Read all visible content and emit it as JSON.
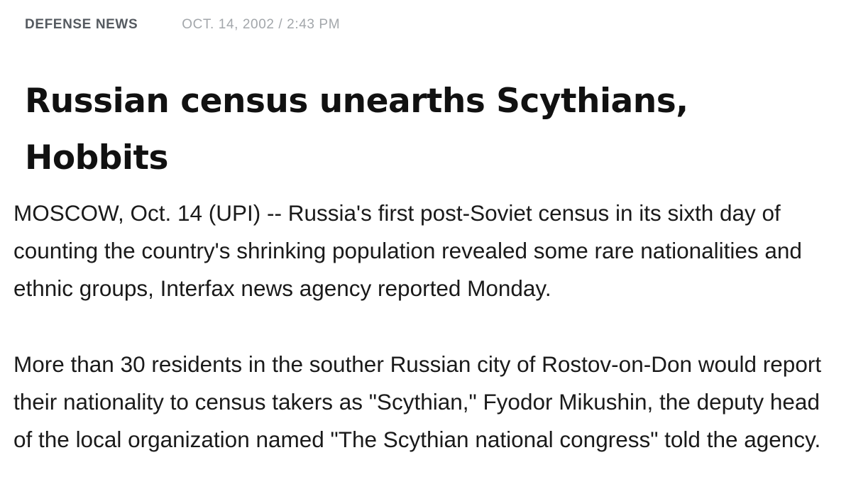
{
  "article": {
    "category": "DEFENSE NEWS",
    "date": "OCT. 14, 2002 / 2:43 PM",
    "headline": "Russian census unearths Scythians, Hobbits",
    "paragraphs": [
      "MOSCOW, Oct. 14 (UPI) -- Russia's first post-Soviet census in its sixth day of counting the country's shrinking population revealed some rare nationalities and ethnic groups, Interfax news agency reported Monday.",
      "More than 30 residents in the souther Russian city of Rostov-on-Don would report their nationality to census takers as \"Scythian,\" Fyodor Mikushin, the deputy head of the local organization named \"The Scythian national congress\" told the agency."
    ]
  },
  "colors": {
    "category": "#555a60",
    "date": "#a3a7ab",
    "headline": "#111111",
    "body": "#1a1a1a",
    "background": "#ffffff"
  }
}
